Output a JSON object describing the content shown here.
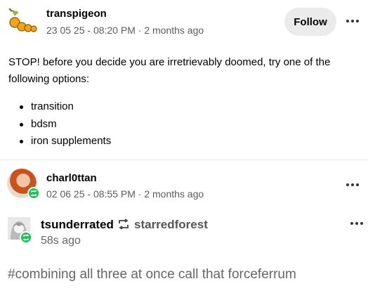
{
  "original_post": {
    "username": "transpigeon",
    "timestamp": "23 05 25 - 08:20 PM",
    "relative_time": "2 months ago",
    "separator": " · ",
    "follow_label": "Follow",
    "avatar_icon": "orange-fruit-icon",
    "body": "STOP! before you decide you are irretrievably doomed, try one of the following options:",
    "options": [
      "transition",
      "bdsm",
      "iron supplements"
    ]
  },
  "reblog": {
    "username": "charl0ttan",
    "timestamp": "02 06 25 - 08:55 PM",
    "relative_time": "2 months ago",
    "separator": " · "
  },
  "current": {
    "username": "tsunderrated",
    "source": "starredforest",
    "time": "58s ago",
    "tag_line": "#combining all three at once call that forceferrum"
  },
  "colors": {
    "reblog_green": "#1fbf54",
    "follow_bg": "#ebebeb",
    "divider": "#e6e6e6"
  },
  "icons": {
    "more": "more-horizontal-icon",
    "reblog": "reblog-icon"
  }
}
